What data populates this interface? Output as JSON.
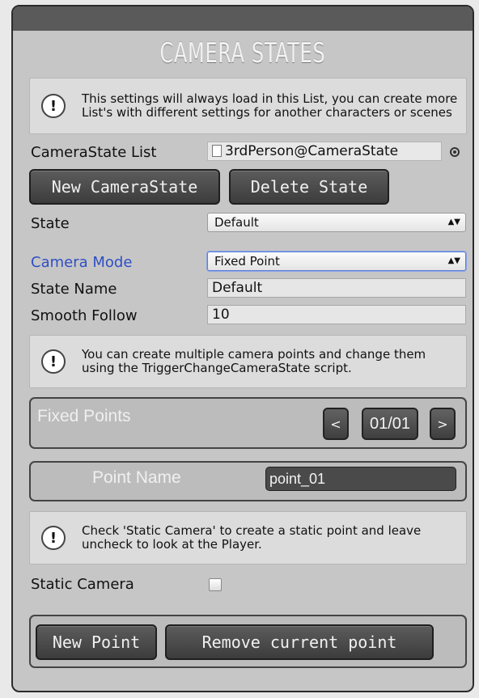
{
  "title": "CAMERA STATES",
  "info": {
    "list_note": "This settings will always load in this List, you can create more List's with different settings for another characters or scenes",
    "multi_points_note": "You can create multiple camera points and change them using the TriggerChangeCameraState script.",
    "static_note": "Check 'Static Camera' to create a static point and leave uncheck to look at the Player.",
    "icon_glyph": "!"
  },
  "camera_state_list": {
    "label": "CameraState List",
    "value": "3rdPerson@CameraState"
  },
  "buttons": {
    "new_camera_state": "New CameraState",
    "delete_state": "Delete State",
    "new_point": "New Point",
    "remove_current_point": "Remove current point"
  },
  "state": {
    "label": "State",
    "value": "Default"
  },
  "camera_mode": {
    "label": "Camera Mode",
    "value": "Fixed Point",
    "label_color": "#2f4fc4"
  },
  "state_name": {
    "label": "State Name",
    "value": "Default"
  },
  "smooth_follow": {
    "label": "Smooth Follow",
    "value": "10"
  },
  "fixed_points": {
    "title": "Fixed Points",
    "prev": "<",
    "next": ">",
    "counter": "01/01"
  },
  "point_name": {
    "label": "Point Name",
    "value": "point_01"
  },
  "static_camera": {
    "label": "Static Camera",
    "checked": false
  },
  "dropdown_arrows": "▲▼"
}
